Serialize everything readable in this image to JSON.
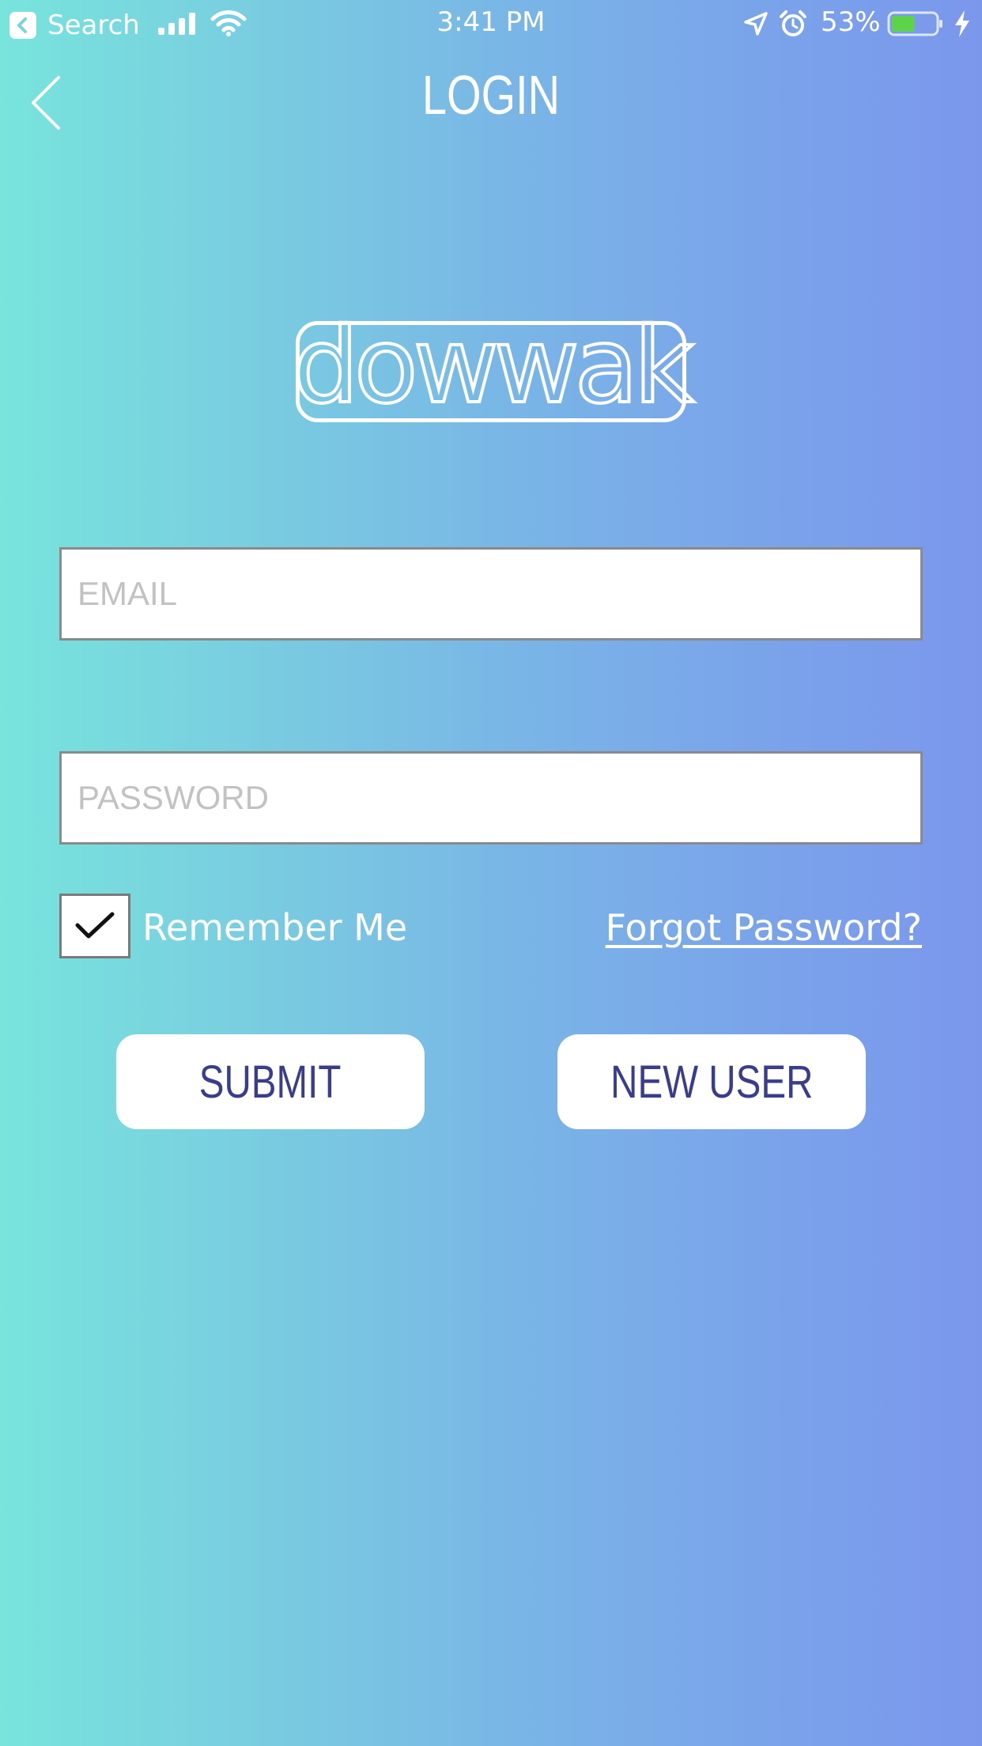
{
  "status_bar": {
    "back_app_label": "Search",
    "time": "3:41 PM",
    "battery_percent": "53%",
    "battery_level": 0.53,
    "battery_color": "#5dd34a",
    "icons": [
      "back-app-icon",
      "signal-icon",
      "wifi-icon",
      "location-icon",
      "alarm-icon",
      "battery-icon",
      "charging-icon"
    ]
  },
  "nav": {
    "title": "LOGIN",
    "back_icon": "chevron-left-icon"
  },
  "logo": {
    "text": "dowwak"
  },
  "form": {
    "email_placeholder": "EMAIL",
    "email_value": "",
    "password_placeholder": "PASSWORD",
    "password_value": "",
    "remember_label": "Remember Me",
    "remember_checked": true,
    "forgot_label": "Forgot Password?"
  },
  "buttons": {
    "submit_label": "SUBMIT",
    "new_user_label": "NEW USER"
  },
  "colors": {
    "gradient_start": "#78e4dc",
    "gradient_end": "#7b97ec",
    "button_text": "#3a3d8c"
  }
}
